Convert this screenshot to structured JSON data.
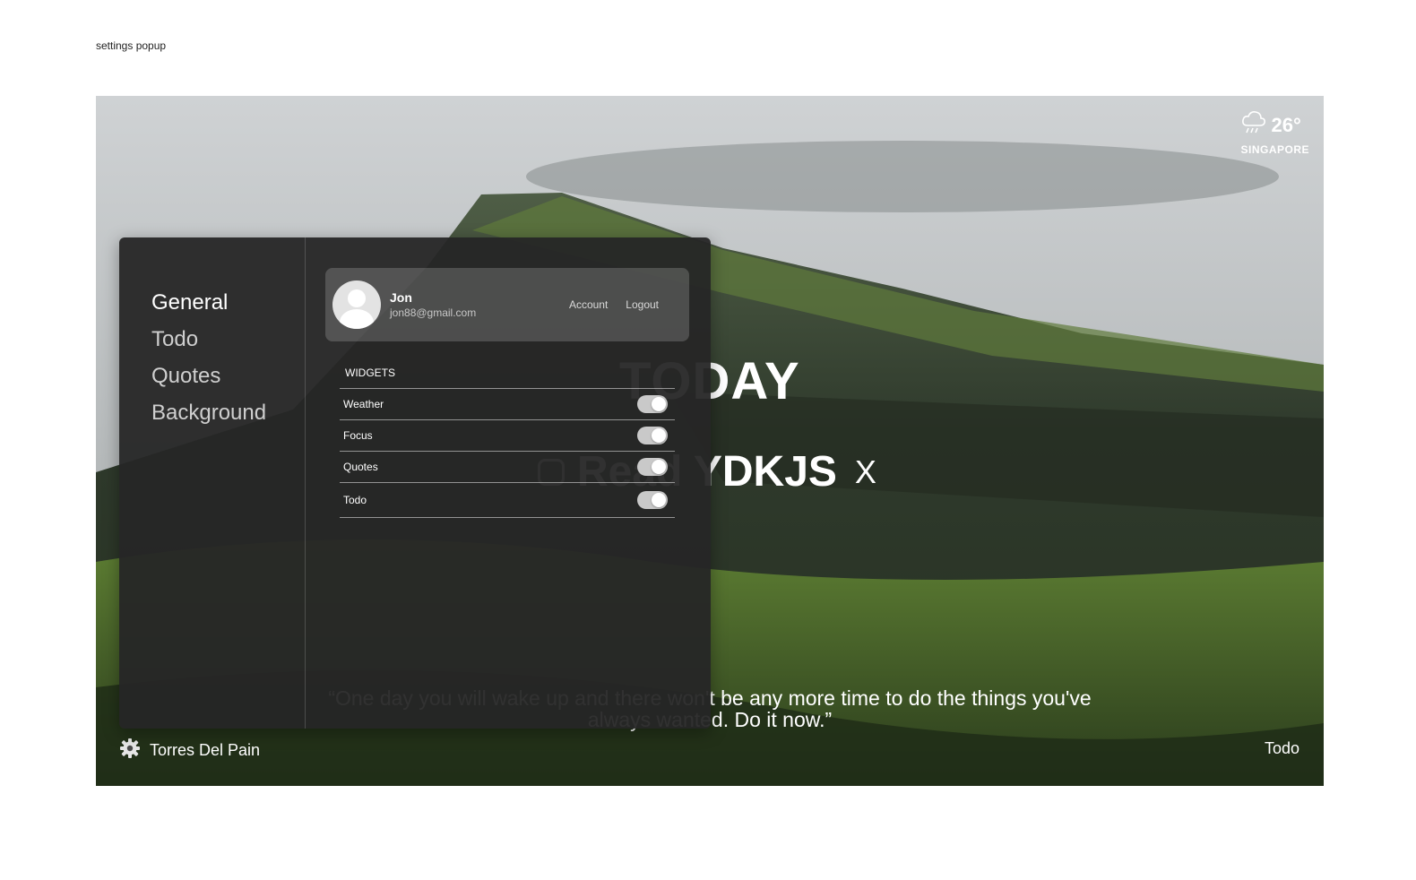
{
  "frame_caption": "settings popup",
  "weather": {
    "temperature": "26°",
    "city": "SINGAPORE",
    "icon": "rain-cloud-icon"
  },
  "focus": {
    "heading": "TODAY",
    "todo_text": "Read YDKJS",
    "remove_label": "X"
  },
  "quote": {
    "text": "“One day you will wake up and there won't be any more time to do the things you've always wanted. Do it now.”"
  },
  "footer": {
    "location": "Torres Del Pain",
    "todo_link": "Todo"
  },
  "settings": {
    "nav": [
      {
        "label": "General",
        "active": true
      },
      {
        "label": "Todo",
        "active": false
      },
      {
        "label": "Quotes",
        "active": false
      },
      {
        "label": "Background",
        "active": false
      }
    ],
    "profile": {
      "name": "Jon",
      "email": "jon88@gmail.com",
      "account_label": "Account",
      "logout_label": "Logout"
    },
    "widgets": {
      "header": "WIDGETS",
      "items": [
        {
          "label": "Weather",
          "enabled": true
        },
        {
          "label": "Focus",
          "enabled": true
        },
        {
          "label": "Quotes",
          "enabled": true
        },
        {
          "label": "Todo",
          "enabled": true
        }
      ]
    }
  }
}
